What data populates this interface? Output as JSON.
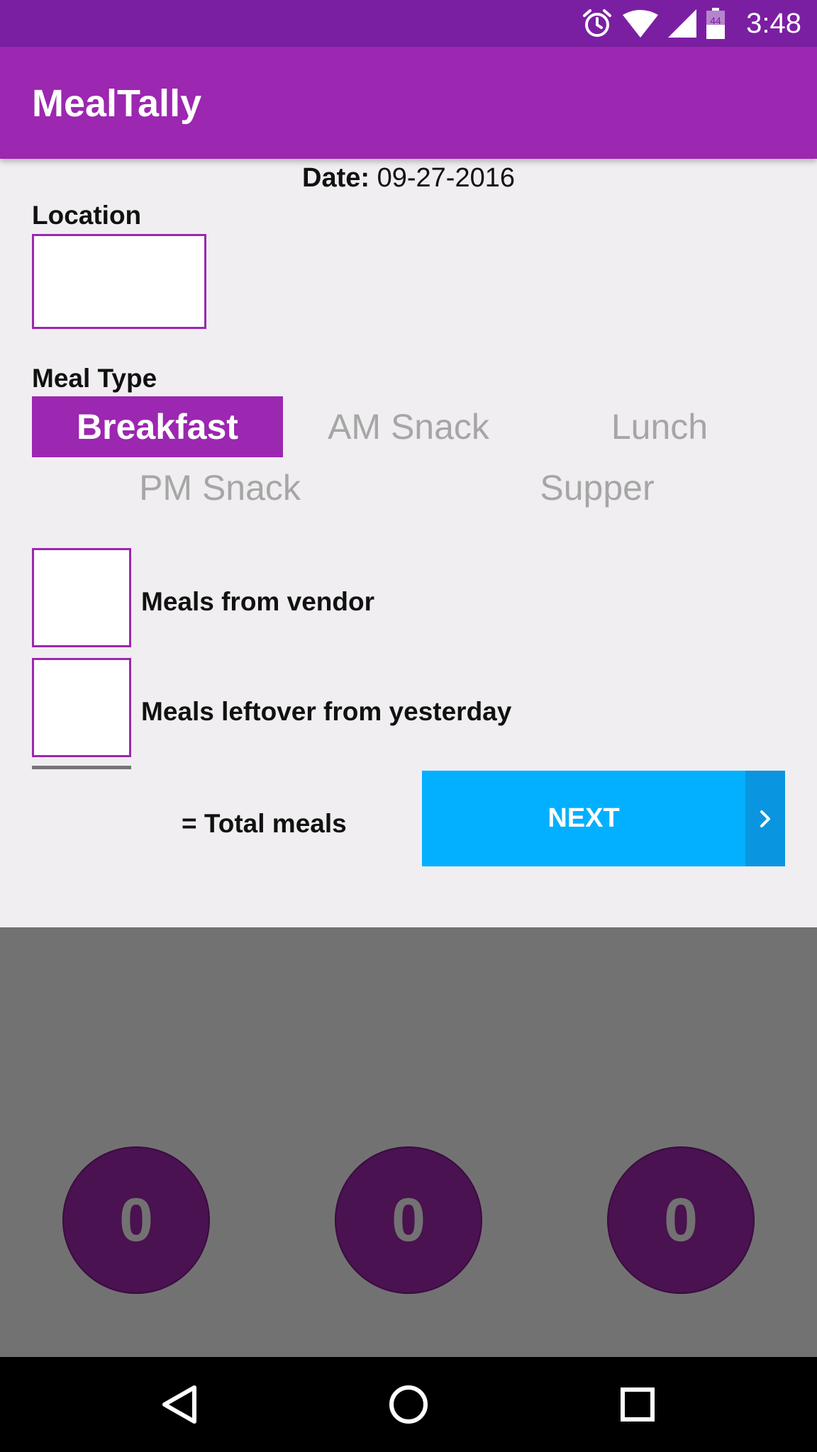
{
  "status_bar": {
    "time": "3:48",
    "battery_level": "44",
    "icons": [
      "alarm-icon",
      "wifi-icon",
      "signal-icon",
      "battery-icon"
    ]
  },
  "app_bar": {
    "title": "MealTally"
  },
  "date": {
    "label": "Date:",
    "value": "09-27-2016"
  },
  "location": {
    "label": "Location",
    "value": ""
  },
  "meal_type": {
    "label": "Meal Type",
    "options": [
      "Breakfast",
      "AM Snack",
      "Lunch",
      "PM Snack",
      "Supper"
    ],
    "selected": "Breakfast"
  },
  "counts": {
    "vendor_label": "Meals from vendor",
    "vendor_value": "",
    "leftover_label": "Meals leftover from yesterday",
    "leftover_value": "",
    "total_label": "= Total meals"
  },
  "next_button": {
    "label": "NEXT"
  },
  "counters": [
    "0",
    "0",
    "0"
  ],
  "colors": {
    "status_bar": "#7b1fa2",
    "app_bar": "#9c27b0",
    "accent": "#9c27b0",
    "next_button": "#03b0ff",
    "counter_circle": "#4a1250",
    "bottom_panel": "#737273"
  },
  "nav_bar": {
    "buttons": [
      "back-icon",
      "home-icon",
      "recents-icon"
    ]
  }
}
